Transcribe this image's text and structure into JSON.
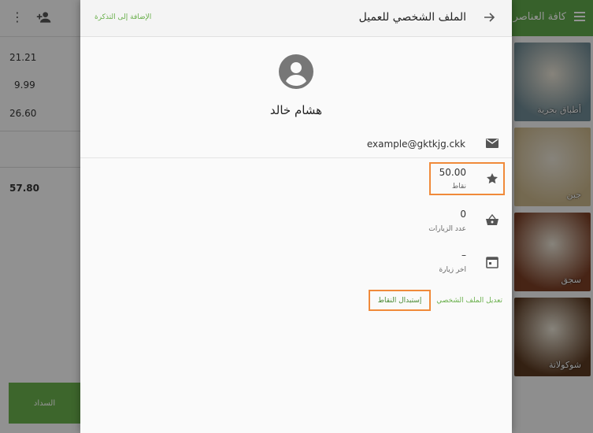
{
  "cart": {
    "amounts": [
      "21.21",
      "9.99",
      "26.60"
    ],
    "total": "57.80",
    "pay_label": "السداد"
  },
  "categories": {
    "header_title": "كافة العناصر",
    "items": [
      {
        "label": "أطباق بحرية",
        "color": "#6f8a94"
      },
      {
        "label": "جبن",
        "color": "#c9b58a"
      },
      {
        "label": "سجق",
        "color": "#7a3e25"
      },
      {
        "label": "شوكولاتة",
        "color": "#5b3a22"
      }
    ]
  },
  "customer_sheet": {
    "title": "الملف الشخصي للعميل",
    "add_to_cart_label": "الإضافة إلى التذكرة",
    "name": "هشام خالد",
    "email": "example@gktkjg.ckk",
    "points": {
      "value": "50.00",
      "label": "نقاط"
    },
    "visits": {
      "value": "0",
      "label": "عدد الزيارات"
    },
    "last_visit": {
      "value": "–",
      "label": "اخر زيارة"
    },
    "edit_profile_label": "تعديل الملف الشخصي",
    "redeem_points_label": "إستبدال النقاط"
  },
  "colors": {
    "accent": "#6ab04c",
    "highlight": "#f08a3a"
  },
  "icons": [
    "more-vert-icon",
    "add-person-icon",
    "menu-icon",
    "arrow-forward-icon",
    "account-circle-icon",
    "email-icon",
    "star-icon",
    "basket-icon",
    "calendar-icon"
  ]
}
